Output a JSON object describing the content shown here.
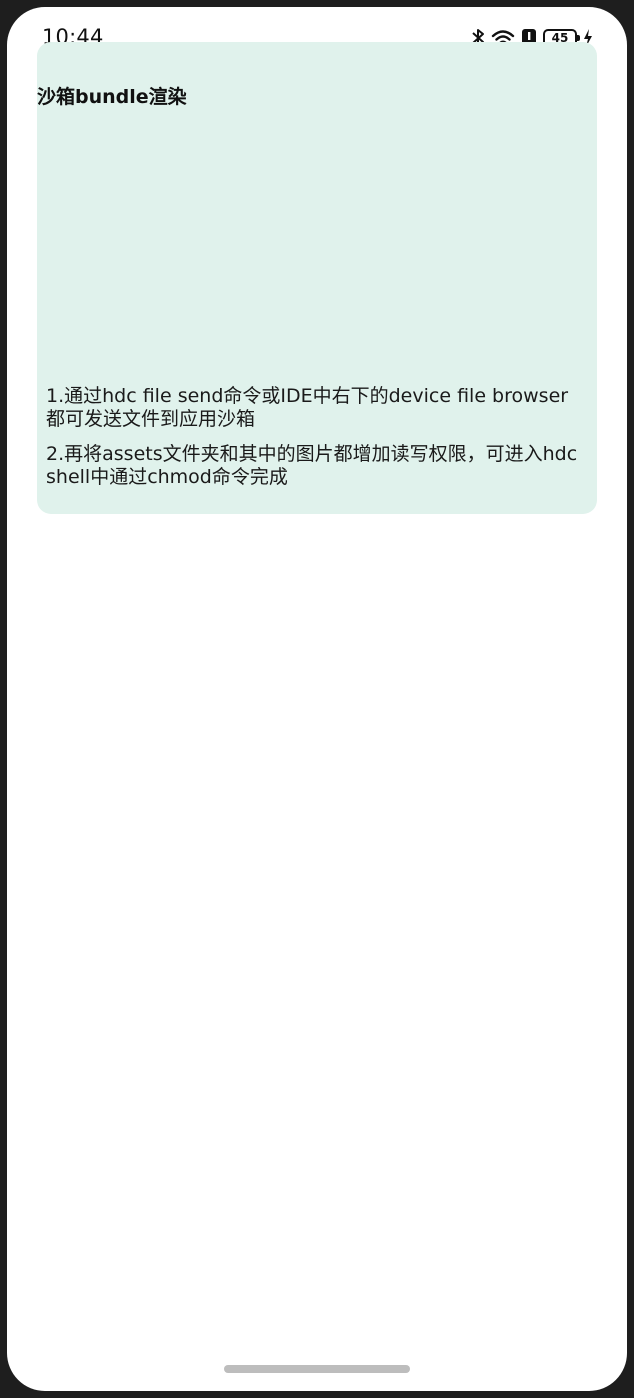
{
  "status_bar": {
    "time": "10:44",
    "battery_level": "45",
    "icons": [
      "bluetooth-icon",
      "wifi-icon",
      "notification-icon",
      "battery-icon",
      "charging-icon"
    ]
  },
  "card": {
    "title": "沙箱bundle渲染",
    "instructions": [
      "1.通过hdc file send命令或IDE中右下的device file browser都可发送文件到应用沙箱",
      "2.再将assets文件夹和其中的图片都增加读写权限，可进入hdc shell中通过chmod命令完成"
    ],
    "background_color": "#e0f2ec"
  }
}
